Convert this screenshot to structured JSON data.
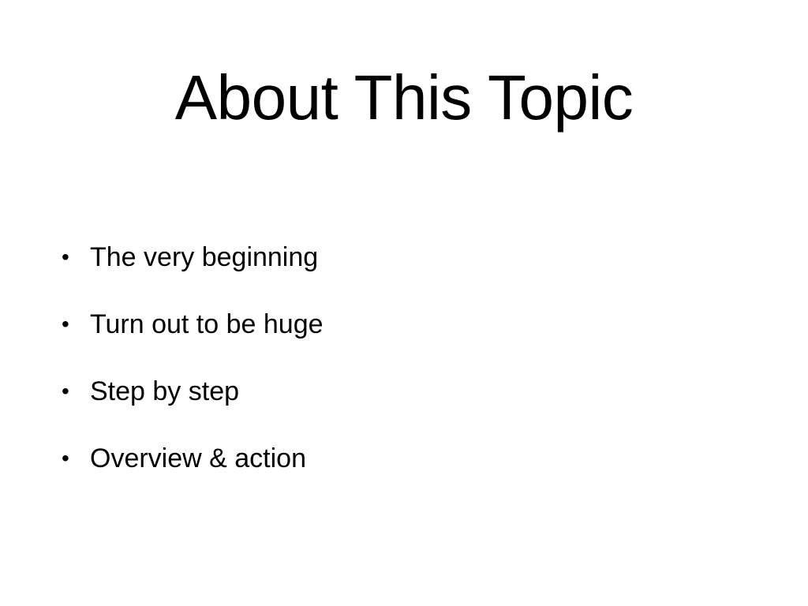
{
  "slide": {
    "title": "About This Topic",
    "bullets": [
      "The very beginning",
      "Turn out to be huge",
      "Step by step",
      "Overview & action"
    ],
    "bullet_glyph": "•"
  },
  "colors": {
    "background": "#ffffff",
    "text": "#000000"
  }
}
